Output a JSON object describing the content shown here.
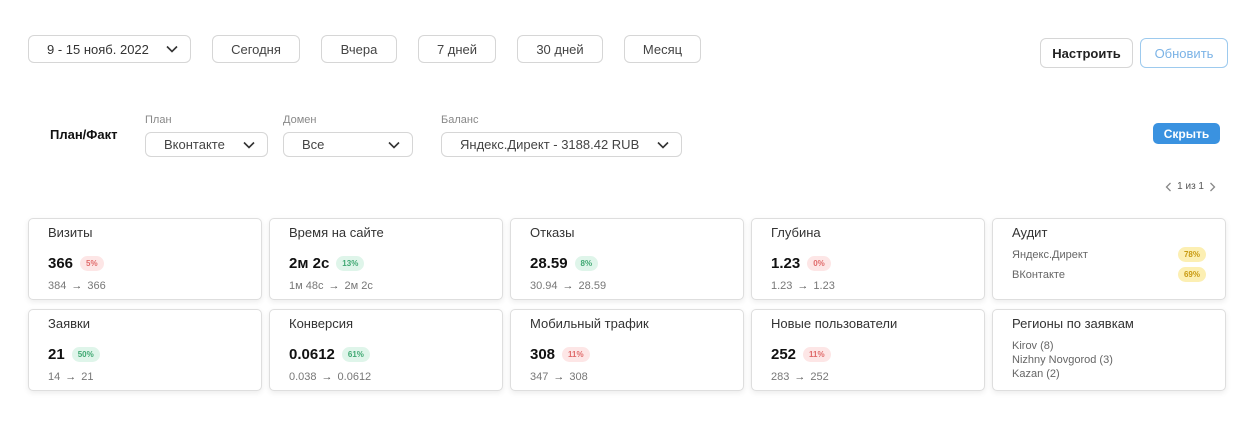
{
  "topbar": {
    "date_range": "9 - 15 нояб. 2022",
    "periods": [
      "Сегодня",
      "Вчера",
      "7 дней",
      "30 дней",
      "Месяц"
    ]
  },
  "actions": {
    "setup_label": "Настроить",
    "refresh_label": "Обновить"
  },
  "filters": {
    "title": "План/Факт",
    "plan": {
      "label": "План",
      "value": "Вконтакте"
    },
    "domain": {
      "label": "Домен",
      "value": "Все"
    },
    "balance": {
      "label": "Баланс",
      "value": "Яндекс.Директ - 3188.42 RUB"
    },
    "hide_label": "Скрыть"
  },
  "pager": {
    "text": "1 из 1"
  },
  "cards": [
    {
      "title": "Визиты",
      "value": "366",
      "badge": "5%",
      "badge_color": "red",
      "from": "384",
      "to": "366"
    },
    {
      "title": "Время на сайте",
      "value": "2м 2с",
      "badge": "13%",
      "badge_color": "green",
      "from": "1м 48с",
      "to": "2м 2с"
    },
    {
      "title": "Отказы",
      "value": "28.59",
      "badge": "8%",
      "badge_color": "green",
      "from": "30.94",
      "to": "28.59"
    },
    {
      "title": "Глубина",
      "value": "1.23",
      "badge": "0%",
      "badge_color": "red",
      "from": "1.23",
      "to": "1.23"
    },
    {
      "title": "Заявки",
      "value": "21",
      "badge": "50%",
      "badge_color": "green",
      "from": "14",
      "to": "21"
    },
    {
      "title": "Конверсия",
      "value": "0.0612",
      "badge": "61%",
      "badge_color": "green",
      "from": "0.038",
      "to": "0.0612"
    },
    {
      "title": "Мобильный трафик",
      "value": "308",
      "badge": "11%",
      "badge_color": "red",
      "from": "347",
      "to": "308"
    },
    {
      "title": "Новые пользователи",
      "value": "252",
      "badge": "11%",
      "badge_color": "red",
      "from": "283",
      "to": "252"
    }
  ],
  "audit": {
    "title": "Аудит",
    "items": [
      {
        "name": "Яндекс.Директ",
        "value": "78%"
      },
      {
        "name": "ВКонтакте",
        "value": "69%"
      }
    ]
  },
  "regions": {
    "title": "Регионы по заявкам",
    "items": [
      "Kirov (8)",
      "Nizhny Novgorod (3)",
      "Kazan (2)"
    ]
  },
  "colors": {
    "accent": "#3a92e0",
    "badge_red_bg": "#fde6e6",
    "badge_green_bg": "#dff5ea",
    "badge_yellow_bg": "#fcefb3"
  }
}
